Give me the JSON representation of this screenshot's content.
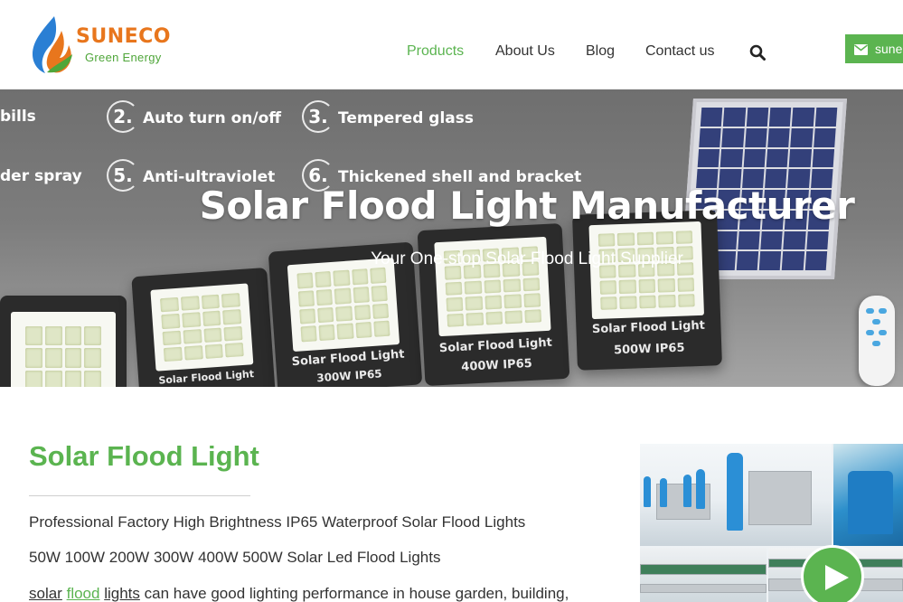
{
  "brand": {
    "name": "SUNECO",
    "tagline": "Green Energy",
    "colors": {
      "green": "#5bb450",
      "orange": "#e8761d",
      "blue": "#2a7fd4"
    }
  },
  "nav": {
    "items": [
      {
        "label": "Products",
        "active": true
      },
      {
        "label": "About Us",
        "active": false
      },
      {
        "label": "Blog",
        "active": false
      },
      {
        "label": "Contact us",
        "active": false
      }
    ],
    "search_icon": "search-icon"
  },
  "header_button": {
    "label": "sune",
    "icon": "envelope-icon"
  },
  "hero": {
    "features": [
      {
        "label": "bills"
      },
      {
        "num": "2.",
        "label": "Auto turn on/off"
      },
      {
        "num": "3.",
        "label": "Tempered glass"
      },
      {
        "label": "der spray"
      },
      {
        "num": "5.",
        "label": "Anti-ultraviolet"
      },
      {
        "num": "6.",
        "label": "Thickened shell and bracket"
      }
    ],
    "title": "Solar Flood Light Manufacturer",
    "subtitle": "Your One-stop Solar Flood Light Supplier",
    "product_labels": [
      {
        "name": "Solar Flood Light",
        "spec": ""
      },
      {
        "name": "Solar Flood Light",
        "spec": "300W IP65"
      },
      {
        "name": "Solar Flood Light",
        "spec": "400W IP65"
      },
      {
        "name": "Solar Flood Light",
        "spec": "500W IP65"
      }
    ]
  },
  "content": {
    "title": "Solar Flood Light",
    "paragraph1": "Professional Factory High Brightness IP65 Waterproof Solar Flood Lights",
    "paragraph2": "50W 100W 200W 300W 400W 500W Solar Led Flood Lights",
    "paragraph3": {
      "link1": "solar",
      "link2": "flood",
      "link3": "lights",
      "rest": " can have good lighting performance in house garden, building,"
    }
  },
  "video": {
    "play_icon": "play-icon"
  }
}
